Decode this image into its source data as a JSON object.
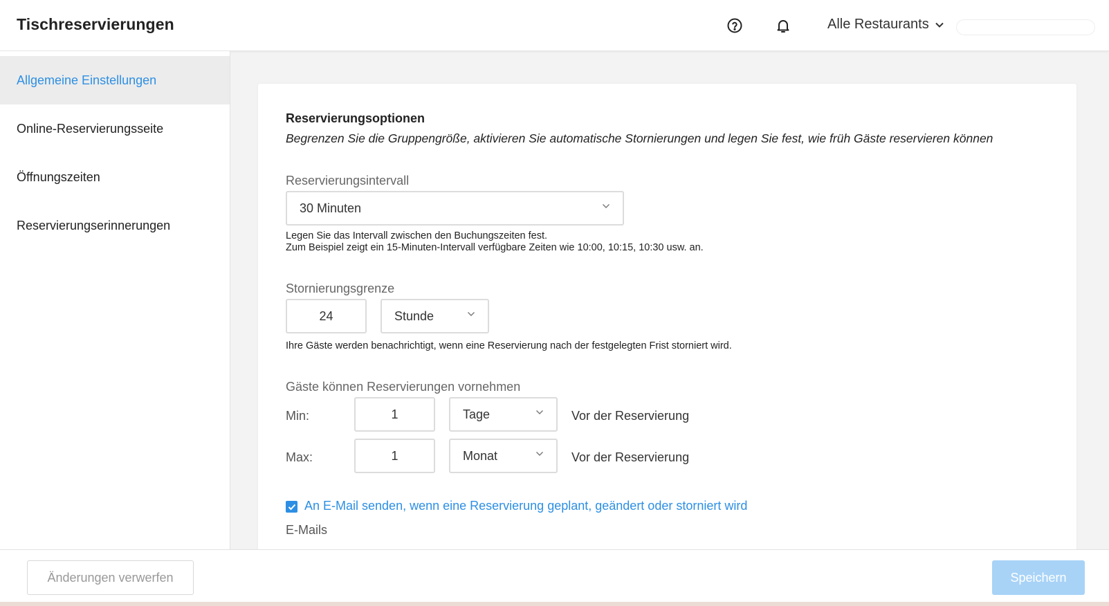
{
  "header": {
    "title": "Tischreservierungen",
    "restaurant_select": "Alle Restaurants"
  },
  "sidebar": {
    "items": [
      {
        "label": "Allgemeine Einstellungen",
        "active": true
      },
      {
        "label": "Online-Reservierungsseite",
        "active": false
      },
      {
        "label": "Öffnungszeiten",
        "active": false
      },
      {
        "label": "Reservierungserinnerungen",
        "active": false
      }
    ]
  },
  "options": {
    "title": "Reservierungsoptionen",
    "subtitle": "Begrenzen Sie die Gruppengröße, aktivieren Sie automatische Stornierungen und legen Sie fest, wie früh Gäste reservieren können",
    "interval": {
      "label": "Reservierungsintervall",
      "value": "30 Minuten",
      "hint_line1": "Legen Sie das Intervall zwischen den Buchungszeiten fest.",
      "hint_line2": "Zum Beispiel zeigt ein 15-Minuten-Intervall verfügbare Zeiten wie 10:00, 10:15, 10:30 usw. an."
    },
    "cancellation": {
      "label": "Stornierungsgrenze",
      "amount": "24",
      "unit": "Stunde",
      "hint": "Ihre Gäste werden benachrichtigt, wenn eine Reservierung nach der festgelegten Frist storniert wird."
    },
    "booking_window": {
      "label": "Gäste können Reservierungen vornehmen",
      "min": {
        "label": "Min:",
        "amount": "1",
        "unit": "Tage",
        "suffix": "Vor der Reservierung"
      },
      "max": {
        "label": "Max:",
        "amount": "1",
        "unit": "Monat",
        "suffix": "Vor der Reservierung"
      }
    },
    "email_notify": {
      "checked": true,
      "label": "An E-Mail senden, wenn eine Reservierung geplant, geändert oder storniert wird"
    },
    "emails_label": "E-Mails"
  },
  "footer": {
    "discard_label": "Änderungen verwerfen",
    "save_label": "Speichern"
  },
  "colors": {
    "accent": "#2d8fe3",
    "save_disabled": "#a8d3f7"
  }
}
